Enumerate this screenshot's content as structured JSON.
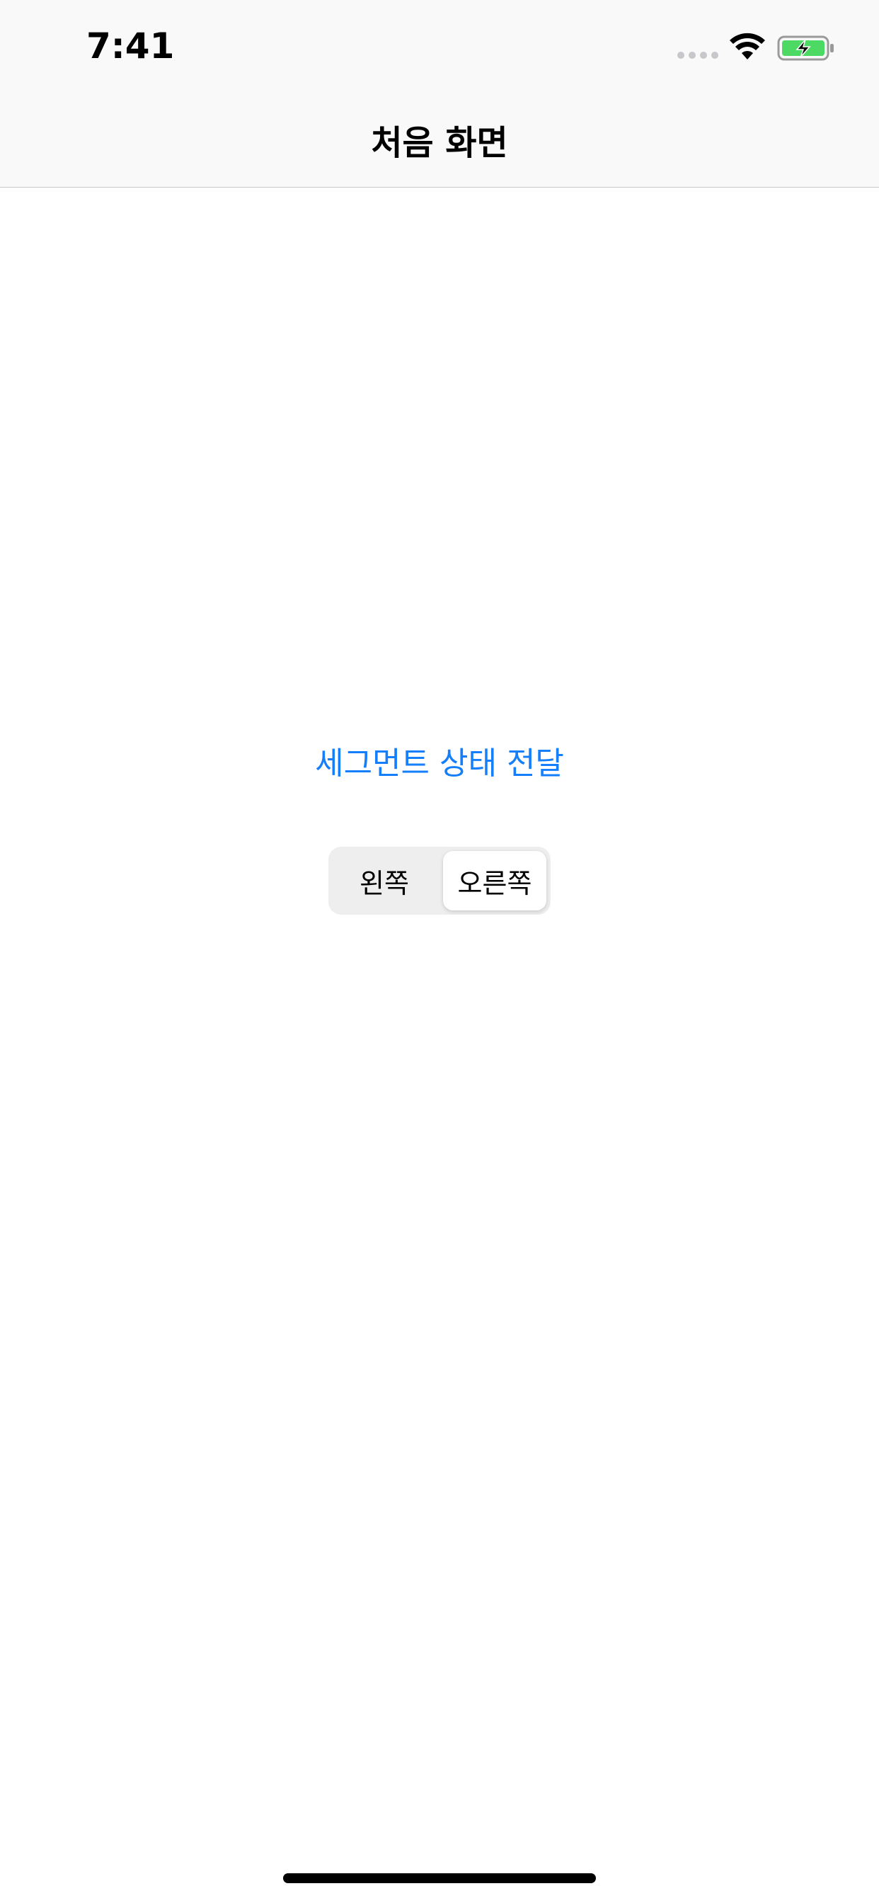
{
  "status_bar": {
    "time": "7:41",
    "signal_icon": "cellular-signal-dots-icon",
    "wifi_icon": "wifi-icon",
    "battery_icon": "battery-charging-icon",
    "battery_color": "#4cd964"
  },
  "nav_bar": {
    "title": "처음 화면"
  },
  "main": {
    "action_link_label": "세그먼트 상태 전달",
    "link_color": "#147efb",
    "segmented_control": {
      "segments": [
        {
          "label": "왼쪽",
          "selected": false
        },
        {
          "label": "오른쪽",
          "selected": true
        }
      ],
      "selected_index": 1
    }
  }
}
